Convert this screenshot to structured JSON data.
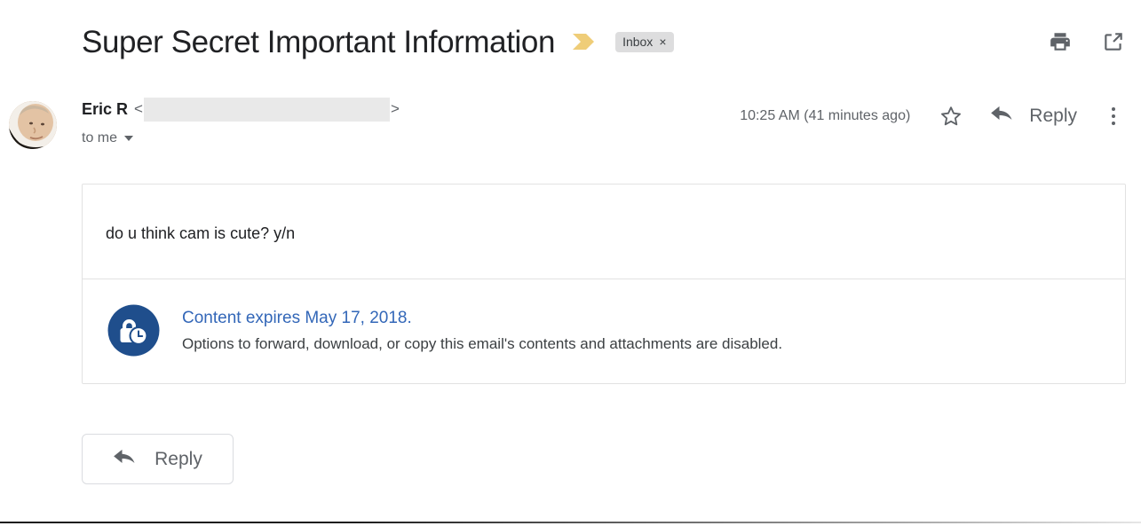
{
  "header": {
    "subject": "Super Secret Important Information",
    "important_marker_icon": "important-chevron-icon",
    "label": {
      "name": "Inbox",
      "remove": "×"
    },
    "actions": [
      {
        "name": "print-icon",
        "label": "Print"
      },
      {
        "name": "open-in-new-window-icon",
        "label": "Open in new window"
      }
    ]
  },
  "message": {
    "avatar_alt": "Eric R profile photo",
    "sender_name": "Eric R",
    "email_open_bracket": "<",
    "email_close_bracket": ">",
    "email_redacted": true,
    "recipients": "to me",
    "timestamp": "10:25 AM (41 minutes ago)",
    "star_icon": "star-outline-icon",
    "reply_icon": "reply-arrow-icon",
    "reply_label": "Reply",
    "more_icon": "more-vertical-icon",
    "body_text": "do u think cam is cute? y/n"
  },
  "confidential": {
    "icon": "lock-clock-icon",
    "title": "Content expires May 17, 2018.",
    "subtitle": "Options to forward, download, or copy this email's contents and attachments are disabled."
  },
  "footer": {
    "reply_button_label": "Reply",
    "reply_button_icon": "reply-arrow-icon"
  },
  "colors": {
    "accent_blue": "#3367b8",
    "important_yellow": "#efcd78",
    "label_chip_bg": "#ddddde",
    "icon_gray": "#5f6368",
    "text_primary": "#202124",
    "border": "#e2e2e2"
  }
}
